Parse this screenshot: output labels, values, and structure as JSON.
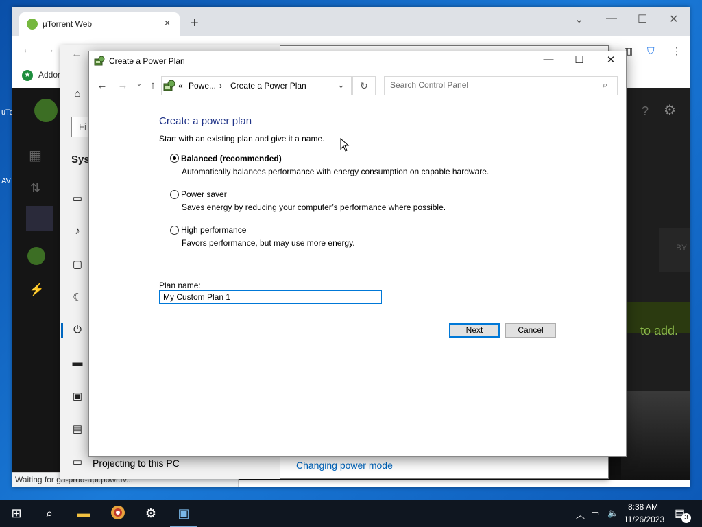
{
  "desktop": {
    "label_1": "uTo",
    "label_2": "AV"
  },
  "browser": {
    "tab_title": "µTorrent Web",
    "tab_close": "×",
    "new_tab": "+",
    "bookmark_label": "Addon",
    "status_text": "Waiting for ga-prod-api.powr.tv...",
    "ut_add_text": "to add.",
    "ut_by_text": "BY"
  },
  "settings_bg": {
    "search_placeholder": "Fi",
    "section_title": "Syst",
    "projecting_label": "Projecting to this PC",
    "link_text": "Changing power mode"
  },
  "dialog": {
    "title": "Create a Power Plan",
    "breadcrumb": {
      "separator_start": "«",
      "parent": "Powe...",
      "separator": "›",
      "current": "Create a Power Plan"
    },
    "search_placeholder": "Search Control Panel",
    "heading": "Create a power plan",
    "intro": "Start with an existing plan and give it a name.",
    "options": [
      {
        "label": "Balanced (recommended)",
        "description": "Automatically balances performance with energy consumption on capable hardware.",
        "selected": true
      },
      {
        "label": "Power saver",
        "description": "Saves energy by reducing your computer’s performance where possible.",
        "selected": false
      },
      {
        "label": "High performance",
        "description": "Favors performance, but may use more energy.",
        "selected": false
      }
    ],
    "plan_name_label": "Plan name:",
    "plan_name_value": "My Custom Plan 1",
    "next_button": "Next",
    "cancel_button": "Cancel"
  },
  "taskbar": {
    "clock_time": "8:38 AM",
    "clock_date": "11/26/2023",
    "notification_count": "3"
  },
  "colors": {
    "accent": "#0078d7",
    "heading": "#1e3287",
    "utorrent_green": "#76b83f"
  }
}
